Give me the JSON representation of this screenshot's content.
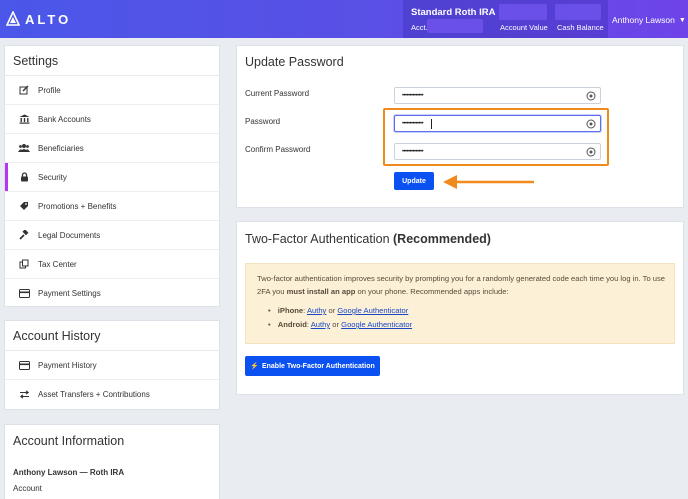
{
  "brand": {
    "logo_text": "ALTO"
  },
  "account": {
    "name": "Standard Roth IRA",
    "acct_label": "Acct.",
    "account_value_label": "Account Value",
    "cash_balance_label": "Cash Balance"
  },
  "user": {
    "name": "Anthony Lawson"
  },
  "colors": {
    "primary": "#0b50f0",
    "accent": "#b537f2",
    "highlight": "#f08a1c",
    "header_start": "#4a57e8",
    "header_end": "#6e44e8"
  },
  "settings": {
    "title": "Settings",
    "items": [
      {
        "label": "Profile",
        "icon": "pencil-square-icon"
      },
      {
        "label": "Bank Accounts",
        "icon": "bank-icon"
      },
      {
        "label": "Beneficiaries",
        "icon": "users-icon"
      },
      {
        "label": "Security",
        "icon": "lock-icon",
        "active": true
      },
      {
        "label": "Promotions + Benefits",
        "icon": "tag-icon"
      },
      {
        "label": "Legal Documents",
        "icon": "gavel-icon"
      },
      {
        "label": "Tax Center",
        "icon": "copy-icon"
      },
      {
        "label": "Payment Settings",
        "icon": "credit-card-icon"
      }
    ]
  },
  "account_history": {
    "title": "Account History",
    "items": [
      {
        "label": "Payment History",
        "icon": "credit-card-icon"
      },
      {
        "label": "Asset Transfers + Contributions",
        "icon": "exchange-icon"
      }
    ]
  },
  "account_information": {
    "title": "Account Information",
    "holder": "Anthony Lawson — Roth IRA",
    "account_label": "Account"
  },
  "update_password": {
    "title": "Update Password",
    "current_label": "Current Password",
    "password_label": "Password",
    "confirm_label": "Confirm Password",
    "current_value": "••••••••••••••",
    "password_value": "••••••••••••••",
    "confirm_value": "••••••••••••••",
    "button_label": "Update"
  },
  "two_factor": {
    "title": "Two-Factor Authentication",
    "title_emphasis": "(Recommended)",
    "text_1": "Two-factor authentication improves security by prompting you for a randomly generated code each time you log in. To use 2FA you",
    "text_bold": "must install an app",
    "text_2": "on your phone. Recommended apps include:",
    "apps": [
      {
        "platform": "iPhone",
        "app1": "Authy",
        "or": "or",
        "app2": "Google Authenticator"
      },
      {
        "platform": "Android",
        "app1": "Authy",
        "or": "or",
        "app2": "Google Authenticator"
      }
    ],
    "button_label": "Enable Two-Factor Authentication"
  }
}
